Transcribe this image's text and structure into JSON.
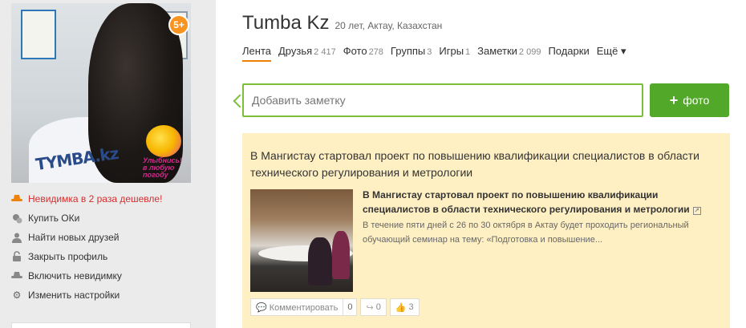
{
  "profile": {
    "name": "Tumba Kz",
    "meta": "20 лет, Актау, Казахстан",
    "age_badge": "5+",
    "avatar_shirt_text": "TYMBA.kz",
    "sticker_text": "Улыбнись! в любую погоду"
  },
  "sidebar": {
    "items": [
      {
        "label": "Невидимка в 2 раза дешевле!",
        "icon": "hat-icon"
      },
      {
        "label": "Купить ОКи",
        "icon": "coins-icon"
      },
      {
        "label": "Найти новых друзей",
        "icon": "user-icon"
      },
      {
        "label": "Закрыть профиль",
        "icon": "lock-icon"
      },
      {
        "label": "Включить невидимку",
        "icon": "hat-icon"
      },
      {
        "label": "Изменить настройки",
        "icon": "gear-icon"
      }
    ]
  },
  "tabs": [
    {
      "label": "Лента",
      "count": ""
    },
    {
      "label": "Друзья",
      "count": "2 417"
    },
    {
      "label": "Фото",
      "count": "278"
    },
    {
      "label": "Группы",
      "count": "3"
    },
    {
      "label": "Игры",
      "count": "1"
    },
    {
      "label": "Заметки",
      "count": "2 099"
    },
    {
      "label": "Подарки",
      "count": ""
    },
    {
      "label": "Ещё",
      "count": ""
    }
  ],
  "note": {
    "placeholder": "Добавить заметку",
    "photo_button": "фото"
  },
  "post": {
    "title": "В Мангистау стартовал проект по повышению квалификации специалистов в области технического регулирования и метрологии",
    "link_title": "В Мангистау стартовал проект по повышению квалификации специалистов в области технического регулирования и метрологии",
    "description": "В течение пяти дней с 26 по 30 октября в Актау будет проходить региональный обучающий семинар на тему: «Подготовка и повышение...",
    "comment_label": "Комментировать",
    "comment_count": "0",
    "share_count": "0",
    "like_count": "3"
  },
  "colors": {
    "accent": "#ee8208",
    "green": "#52a829",
    "input_border": "#7bbf3a",
    "post_bg": "#fff0c4",
    "promo_text": "#d32f2f"
  }
}
